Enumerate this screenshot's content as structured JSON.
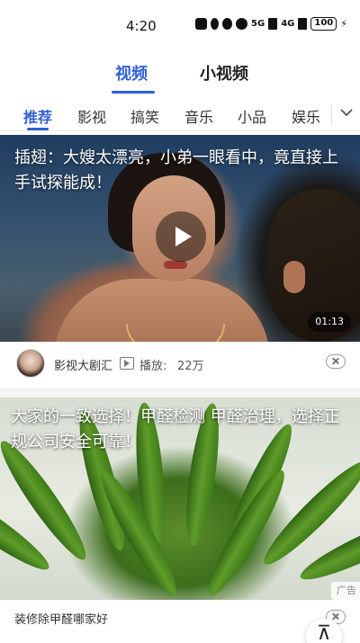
{
  "status_bar": {
    "time": "4:20",
    "signal_1": "5G",
    "signal_2": "4G",
    "battery": "100"
  },
  "top_tabs": [
    {
      "label": "视频",
      "active": true
    },
    {
      "label": "小视频",
      "active": false
    }
  ],
  "categories": [
    {
      "label": "推荐",
      "active": true
    },
    {
      "label": "影视",
      "active": false
    },
    {
      "label": "搞笑",
      "active": false
    },
    {
      "label": "音乐",
      "active": false
    },
    {
      "label": "小品",
      "active": false
    },
    {
      "label": "娱乐",
      "active": false
    }
  ],
  "video_card": {
    "title": "插翅：大嫂太漂亮，小弟一眼看中，竟直接上手试探能成！",
    "duration": "01:13",
    "source": "影视大剧汇",
    "plays_label": "播放:",
    "plays_count": "22万"
  },
  "ad_card": {
    "title": "大家的一致选择！甲醛检测 甲醛治理，选择正规公司安全可靠！",
    "badge": "广告",
    "subtitle": "装修除甲醛哪家好"
  },
  "colors": {
    "accent": "#2f5fd6"
  }
}
